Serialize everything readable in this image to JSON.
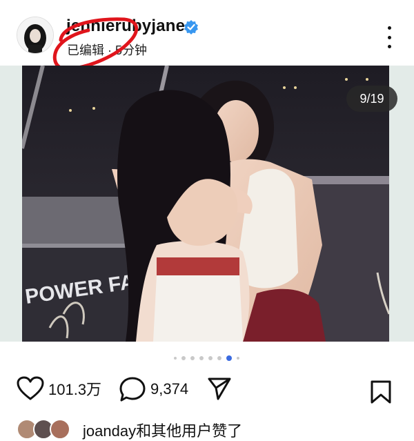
{
  "post": {
    "username": "jennierubyjane",
    "meta": "已编辑 · 5分钟",
    "image_counter": "9/19",
    "photo_sign_text": "POWER FA"
  },
  "carousel": {
    "total_dots": 8,
    "active_index": 6
  },
  "actions": {
    "likes_count": "101.3万",
    "comments_count": "9,374"
  },
  "likes_line": {
    "text": "joanday和其他用户赞了"
  },
  "colors": {
    "verified": "#3897f0",
    "annotation": "#e0151c",
    "dot_active": "#3b6be0"
  }
}
